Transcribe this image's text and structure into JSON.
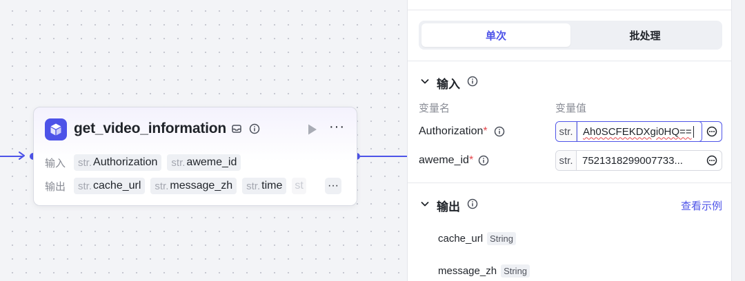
{
  "node": {
    "title": "get_video_information",
    "input_label": "输入",
    "output_label": "输出",
    "inputs": [
      {
        "type": "str.",
        "name": "Authorization"
      },
      {
        "type": "str.",
        "name": "aweme_id"
      }
    ],
    "outputs": [
      {
        "type": "str.",
        "name": "cache_url"
      },
      {
        "type": "str.",
        "name": "message_zh"
      },
      {
        "type": "str.",
        "name": "time"
      },
      {
        "type": "st",
        "name": ""
      }
    ],
    "more_glyph": "···",
    "io_more_glyph": "···"
  },
  "panel": {
    "tabs": {
      "single": "单次",
      "batch": "批处理"
    },
    "input_section": {
      "title": "输入",
      "col_name": "变量名",
      "col_value": "变量值",
      "vars": [
        {
          "name": "Authorization",
          "required_mark": "*",
          "prefix": "str.",
          "value": "Ah0SCFEKDXgi0HQ=="
        },
        {
          "name": "aweme_id",
          "required_mark": "*",
          "prefix": "str.",
          "value": "7521318299007733..."
        }
      ]
    },
    "output_section": {
      "title": "输出",
      "view_example": "查看示例",
      "items": [
        {
          "name": "cache_url",
          "type": "String"
        },
        {
          "name": "message_zh",
          "type": "String"
        }
      ]
    }
  },
  "colors": {
    "accent": "#4d53e8",
    "required": "#e5484d"
  }
}
